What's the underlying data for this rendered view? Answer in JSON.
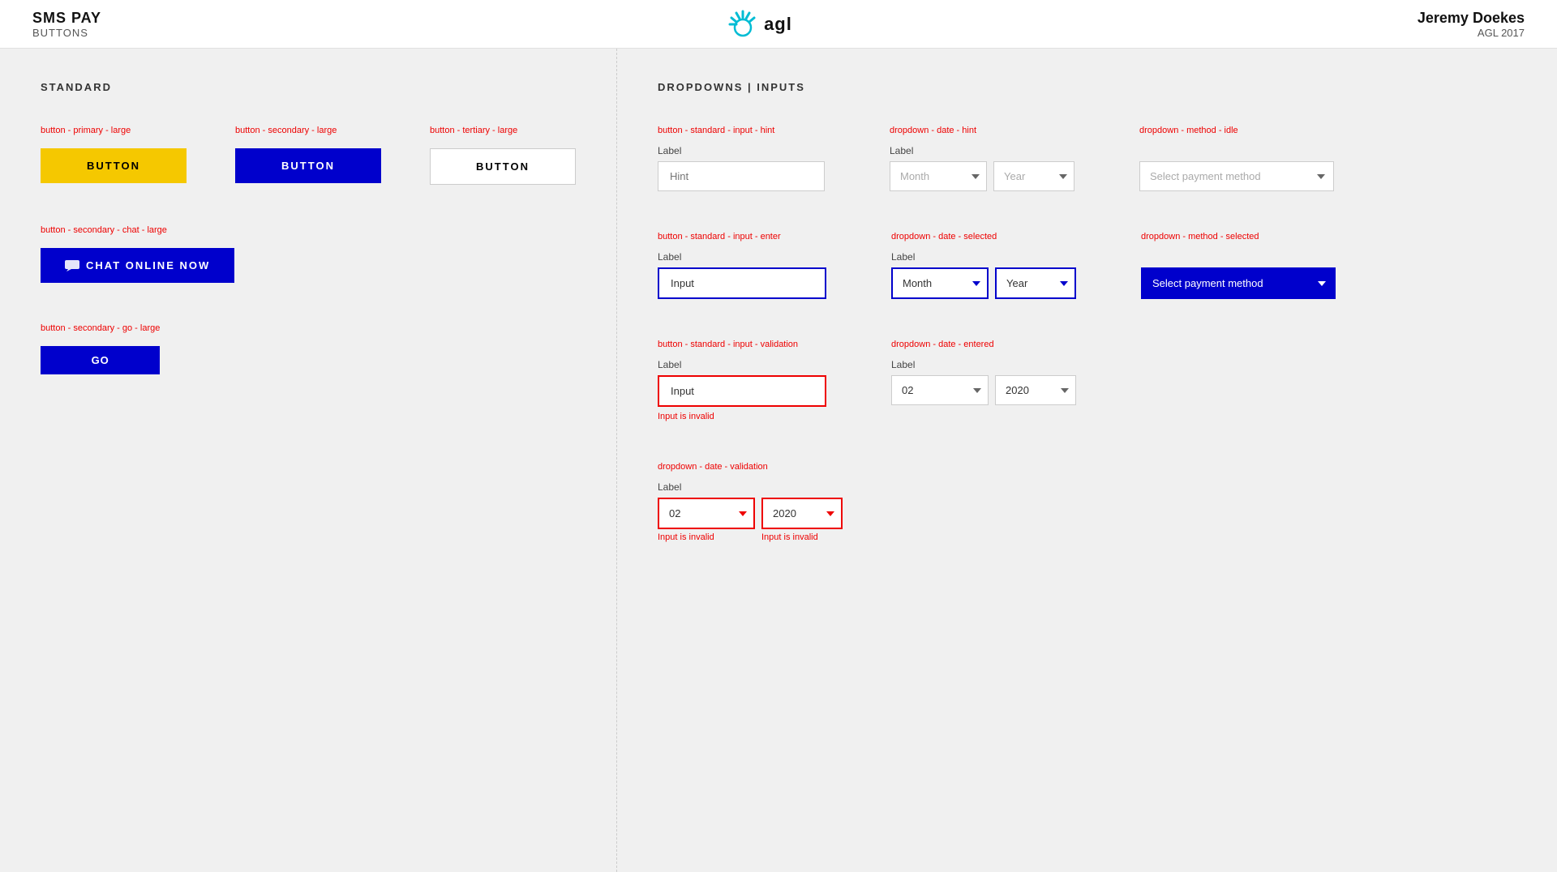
{
  "header": {
    "title": "SMS PAY",
    "subtitle": "BUTTONS",
    "user_name": "Jeremy Doekes",
    "year": "AGL 2017"
  },
  "logo": {
    "text": "agl"
  },
  "left_panel": {
    "section_title": "STANDARD",
    "button_groups": [
      {
        "id": "row1",
        "items": [
          {
            "label": "button - primary - large",
            "button_text": "BUTTON",
            "type": "primary"
          },
          {
            "label": "button - secondary - large",
            "button_text": "BUTTON",
            "type": "secondary"
          },
          {
            "label": "button - tertiary - large",
            "button_text": "BUTTON",
            "type": "tertiary"
          }
        ]
      },
      {
        "id": "row2",
        "items": [
          {
            "label": "button - secondary - chat - large",
            "button_text": "CHAT ONLINE NOW",
            "type": "chat"
          }
        ]
      },
      {
        "id": "row3",
        "items": [
          {
            "label": "button - secondary - go - large",
            "button_text": "GO",
            "type": "go"
          }
        ]
      }
    ]
  },
  "right_panel": {
    "section_title": "DROPDOWNS | INPUTS",
    "rows": [
      {
        "id": "row1",
        "items": [
          {
            "id": "input-hint",
            "label_top": "button - standard - input - hint",
            "label": "Label",
            "placeholder": "Hint",
            "type": "input-hint"
          },
          {
            "id": "dropdown-date-hint",
            "label_top": "dropdown - date - hint",
            "label": "Label",
            "month_placeholder": "Month",
            "year_placeholder": "Year",
            "type": "date-hint"
          },
          {
            "id": "dropdown-method-idle",
            "label_top": "dropdown - method - idle",
            "label": "",
            "placeholder": "Select payment method",
            "type": "method-idle"
          }
        ]
      },
      {
        "id": "row2",
        "items": [
          {
            "id": "input-enter",
            "label_top": "button - standard - input - enter",
            "label": "Label",
            "value": "Input",
            "type": "input-enter"
          },
          {
            "id": "dropdown-date-selected",
            "label_top": "dropdown - date - selected",
            "label": "Label",
            "month_value": "Month",
            "year_value": "Year",
            "type": "date-selected"
          },
          {
            "id": "dropdown-method-selected",
            "label_top": "dropdown - method - selected",
            "label": "",
            "value": "Select payment method",
            "type": "method-selected"
          }
        ]
      },
      {
        "id": "row3",
        "items": [
          {
            "id": "input-validation",
            "label_top": "button - standard - input - validation",
            "label": "Label",
            "value": "Input",
            "error": "Input is invalid",
            "type": "input-validation"
          },
          {
            "id": "dropdown-date-entered",
            "label_top": "dropdown - date - entered",
            "label": "Label",
            "month_value": "02",
            "year_value": "2020",
            "type": "date-entered"
          }
        ]
      },
      {
        "id": "row4",
        "items": [
          {
            "id": "dropdown-date-validation",
            "label_top": "dropdown - date - validation",
            "label": "Label",
            "month_value": "02",
            "year_value": "2020",
            "month_error": "Input is invalid",
            "year_error": "Input is invalid",
            "type": "date-validation"
          }
        ]
      }
    ]
  }
}
